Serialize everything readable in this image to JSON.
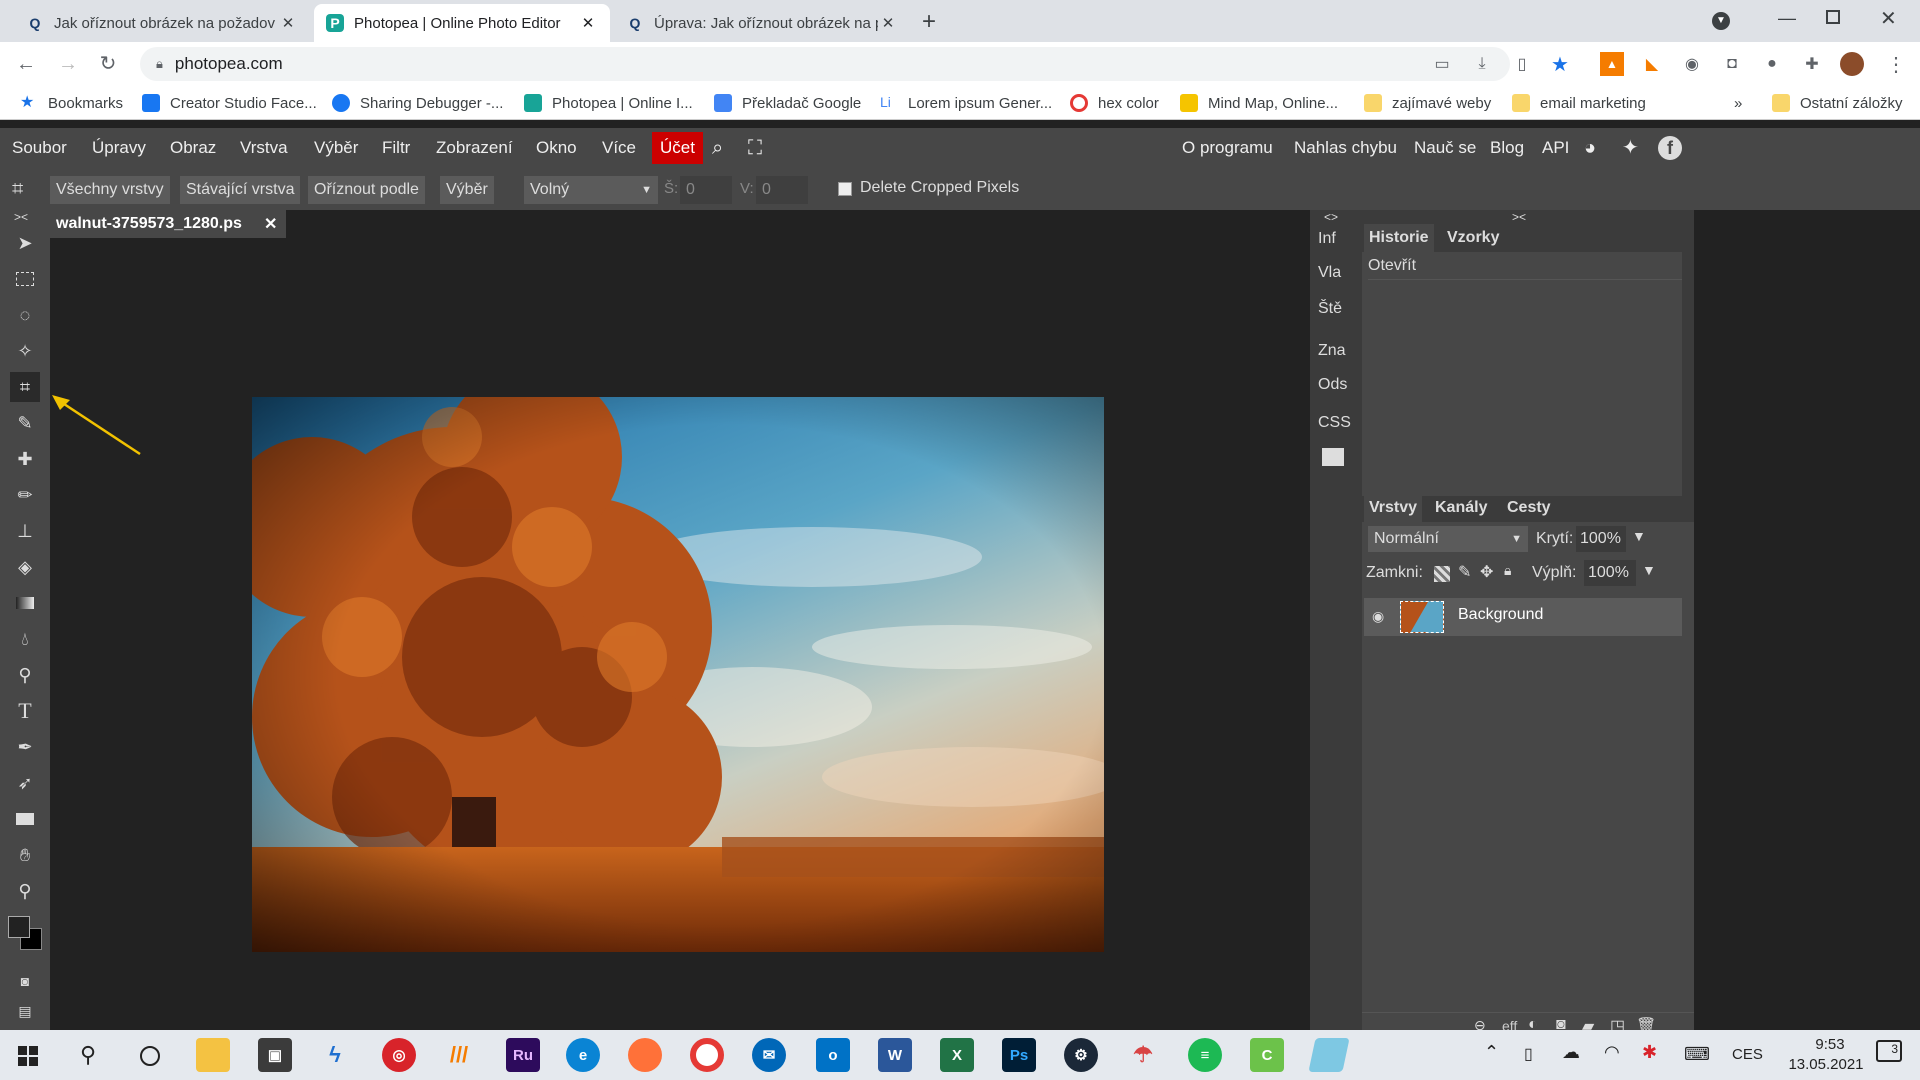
{
  "browser": {
    "tabs": [
      {
        "title": "Jak oříznout obrázek na požadov",
        "favicon": "Q"
      },
      {
        "title": "Photopea | Online Photo Editor",
        "favicon": "P"
      },
      {
        "title": "Úprava: Jak oříznout obrázek na p",
        "favicon": "Q"
      }
    ],
    "url": "photopea.com",
    "bookmarks": [
      "Bookmarks",
      "Creator Studio Face...",
      "Sharing Debugger -...",
      "Photopea | Online I...",
      "Překladač Google",
      "Lorem ipsum Gener...",
      "hex color",
      "Mind Map, Online...",
      "zajímavé weby",
      "email marketing",
      "Ostatní záložky"
    ],
    "bookmarks_more": "»"
  },
  "menu": {
    "items": [
      "Soubor",
      "Úpravy",
      "Obraz",
      "Vrstva",
      "Výběr",
      "Filtr",
      "Zobrazení",
      "Okno",
      "Více"
    ],
    "account": "Účet",
    "right_items": [
      "O programu",
      "Nahlas chybu",
      "Nauč se",
      "Blog",
      "API"
    ]
  },
  "options": {
    "buttons": [
      "Všechny vrstvy",
      "Stávající vrstva",
      "Oříznout podle",
      "Výběr"
    ],
    "ratio": "Volný",
    "w_label": "Š:",
    "w_value": "0",
    "h_label": "V:",
    "h_value": "0",
    "delete_cropped": "Delete Cropped Pixels"
  },
  "document": {
    "tab_title": "walnut-3759573_1280.ps",
    "close": "✕"
  },
  "right_strip": {
    "toggle": "<>",
    "items": [
      "Inf",
      "Vla",
      "Ště",
      "Zna",
      "Ods",
      "CSS"
    ]
  },
  "panel": {
    "toggle": "><",
    "history_tab": "Historie",
    "swatches_tab": "Vzorky",
    "history_items": [
      "Otevřít"
    ],
    "layers_tab": "Vrstvy",
    "channels_tab": "Kanály",
    "paths_tab": "Cesty",
    "blend_mode": "Normální",
    "opacity_label": "Krytí:",
    "opacity_value": "100%",
    "lock_label": "Zamkni:",
    "fill_label": "Výplň:",
    "fill_value": "100%",
    "layers": [
      {
        "name": "Background"
      }
    ],
    "footer_eff": "eff"
  },
  "toolbar": {
    "toggle": "><"
  },
  "taskbar": {
    "lang": "CES",
    "time": "9:53",
    "date": "13.05.2021",
    "notifications": "3",
    "apps": [
      "Ru",
      "Ps"
    ]
  },
  "colors": {
    "accent": "#cc0000",
    "menu_bg": "#474747",
    "panel_bg": "#3b3b3b",
    "arrow": "#f2c200"
  }
}
